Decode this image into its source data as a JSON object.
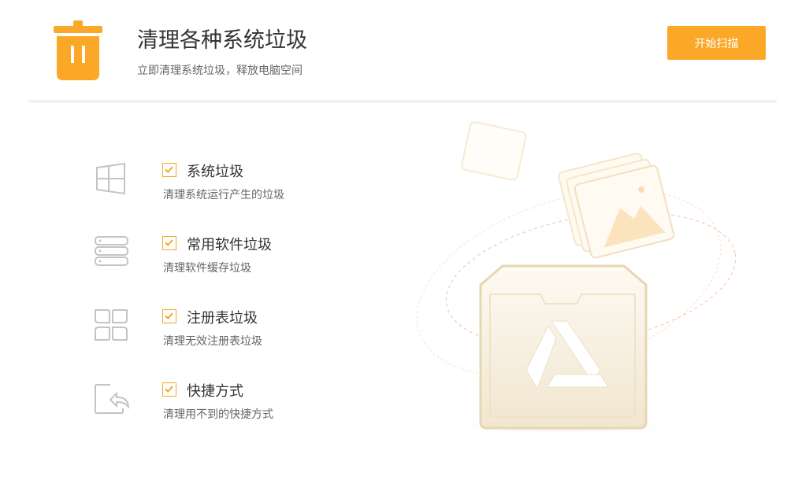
{
  "header": {
    "title": "清理各种系统垃圾",
    "subtitle": "立即清理系统垃圾，释放电脑空间",
    "scan_button_label": "开始扫描",
    "icon": "trash-icon"
  },
  "colors": {
    "accent": "#fba828",
    "checkbox": "#f5a623",
    "title_text": "#333333",
    "desc_text": "#666666",
    "divider": "#f2f2f2"
  },
  "items": [
    {
      "icon": "windows-icon",
      "title": "系统垃圾",
      "desc": "清理系统运行产生的垃圾",
      "checked": true
    },
    {
      "icon": "server-icon",
      "title": "常用软件垃圾",
      "desc": "清理软件缓存垃圾",
      "checked": true
    },
    {
      "icon": "registry-icon",
      "title": "注册表垃圾",
      "desc": "清理无效注册表垃圾",
      "checked": true
    },
    {
      "icon": "shortcut-icon",
      "title": "快捷方式",
      "desc": "清理用不到的快捷方式",
      "checked": true
    }
  ]
}
